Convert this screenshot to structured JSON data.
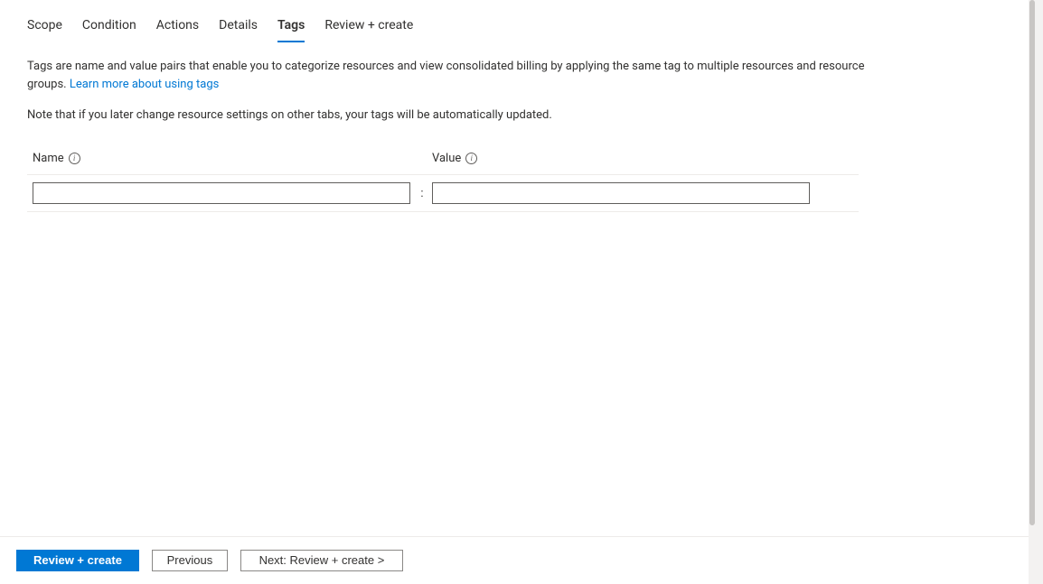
{
  "tabs": [
    {
      "label": "Scope",
      "active": false
    },
    {
      "label": "Condition",
      "active": false
    },
    {
      "label": "Actions",
      "active": false
    },
    {
      "label": "Details",
      "active": false
    },
    {
      "label": "Tags",
      "active": true
    },
    {
      "label": "Review + create",
      "active": false
    }
  ],
  "description": {
    "text": "Tags are name and value pairs that enable you to categorize resources and view consolidated billing by applying the same tag to multiple resources and resource groups. ",
    "link_text": "Learn more about using tags"
  },
  "note": "Note that if you later change resource settings on other tabs, your tags will be automatically updated.",
  "columns": {
    "name_label": "Name",
    "value_label": "Value",
    "separator": ":"
  },
  "row": {
    "name_value": "",
    "value_value": ""
  },
  "footer": {
    "review_create": "Review + create",
    "previous": "Previous",
    "next": "Next: Review + create >"
  }
}
